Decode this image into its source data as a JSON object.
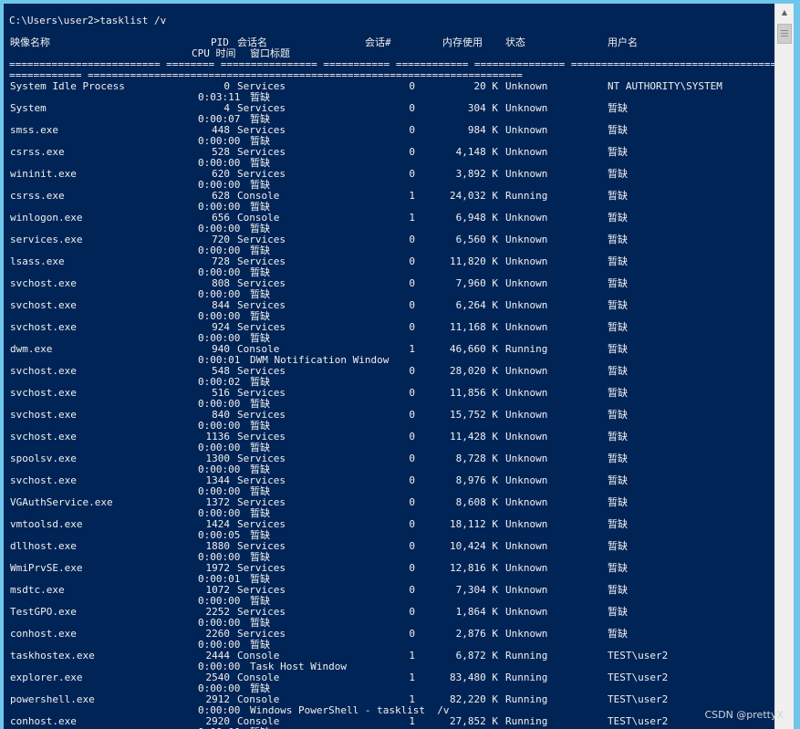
{
  "prompt_line": "C:\\Users\\user2>tasklist /v",
  "headers": {
    "image_name": "映像名称",
    "pid": "PID",
    "session_name": "会话名",
    "session_num": "会话#",
    "mem_usage": "内存使用",
    "status": "状态",
    "user_name": "用户名",
    "cpu_time": "CPU 时间",
    "window_title": "窗口标题"
  },
  "separator_line1": "========================= ======== ================ =========== ============ =============== ==================================================",
  "separator_line2": "============ ========================================================================",
  "processes": [
    {
      "name": "System Idle Process",
      "pid": "0",
      "session": "Services",
      "snum": "0",
      "mem": "20 K",
      "status": "Unknown",
      "user": "NT AUTHORITY\\SYSTEM",
      "cpu": "0:03:11",
      "title": "暂缺"
    },
    {
      "name": "System",
      "pid": "4",
      "session": "Services",
      "snum": "0",
      "mem": "304 K",
      "status": "Unknown",
      "user": "暂缺",
      "cpu": "0:00:07",
      "title": "暂缺"
    },
    {
      "name": "smss.exe",
      "pid": "448",
      "session": "Services",
      "snum": "0",
      "mem": "984 K",
      "status": "Unknown",
      "user": "暂缺",
      "cpu": "0:00:00",
      "title": "暂缺"
    },
    {
      "name": "csrss.exe",
      "pid": "528",
      "session": "Services",
      "snum": "0",
      "mem": "4,148 K",
      "status": "Unknown",
      "user": "暂缺",
      "cpu": "0:00:00",
      "title": "暂缺"
    },
    {
      "name": "wininit.exe",
      "pid": "620",
      "session": "Services",
      "snum": "0",
      "mem": "3,892 K",
      "status": "Unknown",
      "user": "暂缺",
      "cpu": "0:00:00",
      "title": "暂缺"
    },
    {
      "name": "csrss.exe",
      "pid": "628",
      "session": "Console",
      "snum": "1",
      "mem": "24,032 K",
      "status": "Running",
      "user": "暂缺",
      "cpu": "0:00:00",
      "title": "暂缺"
    },
    {
      "name": "winlogon.exe",
      "pid": "656",
      "session": "Console",
      "snum": "1",
      "mem": "6,948 K",
      "status": "Unknown",
      "user": "暂缺",
      "cpu": "0:00:00",
      "title": "暂缺"
    },
    {
      "name": "services.exe",
      "pid": "720",
      "session": "Services",
      "snum": "0",
      "mem": "6,560 K",
      "status": "Unknown",
      "user": "暂缺",
      "cpu": "0:00:00",
      "title": "暂缺"
    },
    {
      "name": "lsass.exe",
      "pid": "728",
      "session": "Services",
      "snum": "0",
      "mem": "11,820 K",
      "status": "Unknown",
      "user": "暂缺",
      "cpu": "0:00:00",
      "title": "暂缺"
    },
    {
      "name": "svchost.exe",
      "pid": "808",
      "session": "Services",
      "snum": "0",
      "mem": "7,960 K",
      "status": "Unknown",
      "user": "暂缺",
      "cpu": "0:00:00",
      "title": "暂缺"
    },
    {
      "name": "svchost.exe",
      "pid": "844",
      "session": "Services",
      "snum": "0",
      "mem": "6,264 K",
      "status": "Unknown",
      "user": "暂缺",
      "cpu": "0:00:00",
      "title": "暂缺"
    },
    {
      "name": "svchost.exe",
      "pid": "924",
      "session": "Services",
      "snum": "0",
      "mem": "11,168 K",
      "status": "Unknown",
      "user": "暂缺",
      "cpu": "0:00:00",
      "title": "暂缺"
    },
    {
      "name": "dwm.exe",
      "pid": "940",
      "session": "Console",
      "snum": "1",
      "mem": "46,660 K",
      "status": "Running",
      "user": "暂缺",
      "cpu": "0:00:01",
      "title": "DWM Notification Window"
    },
    {
      "name": "svchost.exe",
      "pid": "548",
      "session": "Services",
      "snum": "0",
      "mem": "28,020 K",
      "status": "Unknown",
      "user": "暂缺",
      "cpu": "0:00:02",
      "title": "暂缺"
    },
    {
      "name": "svchost.exe",
      "pid": "516",
      "session": "Services",
      "snum": "0",
      "mem": "11,856 K",
      "status": "Unknown",
      "user": "暂缺",
      "cpu": "0:00:00",
      "title": "暂缺"
    },
    {
      "name": "svchost.exe",
      "pid": "840",
      "session": "Services",
      "snum": "0",
      "mem": "15,752 K",
      "status": "Unknown",
      "user": "暂缺",
      "cpu": "0:00:00",
      "title": "暂缺"
    },
    {
      "name": "svchost.exe",
      "pid": "1136",
      "session": "Services",
      "snum": "0",
      "mem": "11,428 K",
      "status": "Unknown",
      "user": "暂缺",
      "cpu": "0:00:00",
      "title": "暂缺"
    },
    {
      "name": "spoolsv.exe",
      "pid": "1300",
      "session": "Services",
      "snum": "0",
      "mem": "8,728 K",
      "status": "Unknown",
      "user": "暂缺",
      "cpu": "0:00:00",
      "title": "暂缺"
    },
    {
      "name": "svchost.exe",
      "pid": "1344",
      "session": "Services",
      "snum": "0",
      "mem": "8,976 K",
      "status": "Unknown",
      "user": "暂缺",
      "cpu": "0:00:00",
      "title": "暂缺"
    },
    {
      "name": "VGAuthService.exe",
      "pid": "1372",
      "session": "Services",
      "snum": "0",
      "mem": "8,608 K",
      "status": "Unknown",
      "user": "暂缺",
      "cpu": "0:00:00",
      "title": "暂缺"
    },
    {
      "name": "vmtoolsd.exe",
      "pid": "1424",
      "session": "Services",
      "snum": "0",
      "mem": "18,112 K",
      "status": "Unknown",
      "user": "暂缺",
      "cpu": "0:00:05",
      "title": "暂缺"
    },
    {
      "name": "dllhost.exe",
      "pid": "1880",
      "session": "Services",
      "snum": "0",
      "mem": "10,424 K",
      "status": "Unknown",
      "user": "暂缺",
      "cpu": "0:00:00",
      "title": "暂缺"
    },
    {
      "name": "WmiPrvSE.exe",
      "pid": "1972",
      "session": "Services",
      "snum": "0",
      "mem": "12,816 K",
      "status": "Unknown",
      "user": "暂缺",
      "cpu": "0:00:01",
      "title": "暂缺"
    },
    {
      "name": "msdtc.exe",
      "pid": "1072",
      "session": "Services",
      "snum": "0",
      "mem": "7,304 K",
      "status": "Unknown",
      "user": "暂缺",
      "cpu": "0:00:00",
      "title": "暂缺"
    },
    {
      "name": "TestGPO.exe",
      "pid": "2252",
      "session": "Services",
      "snum": "0",
      "mem": "1,864 K",
      "status": "Unknown",
      "user": "暂缺",
      "cpu": "0:00:00",
      "title": "暂缺"
    },
    {
      "name": "conhost.exe",
      "pid": "2260",
      "session": "Services",
      "snum": "0",
      "mem": "2,876 K",
      "status": "Unknown",
      "user": "暂缺",
      "cpu": "0:00:00",
      "title": "暂缺"
    },
    {
      "name": "taskhostex.exe",
      "pid": "2444",
      "session": "Console",
      "snum": "1",
      "mem": "6,872 K",
      "status": "Running",
      "user": "TEST\\user2",
      "cpu": "0:00:00",
      "title": "Task Host Window"
    },
    {
      "name": "explorer.exe",
      "pid": "2540",
      "session": "Console",
      "snum": "1",
      "mem": "83,480 K",
      "status": "Running",
      "user": "TEST\\user2",
      "cpu": "0:00:00",
      "title": "暂缺"
    },
    {
      "name": "powershell.exe",
      "pid": "2912",
      "session": "Console",
      "snum": "1",
      "mem": "82,220 K",
      "status": "Running",
      "user": "TEST\\user2",
      "cpu": "0:00:00",
      "title": "Windows PowerShell - tasklist  /v"
    },
    {
      "name": "conhost.exe",
      "pid": "2920",
      "session": "Console",
      "snum": "1",
      "mem": "27,852 K",
      "status": "Running",
      "user": "TEST\\user2",
      "cpu": "0:00:00",
      "title": "暂缺"
    }
  ],
  "watermark": "CSDN @prettyX",
  "colors": {
    "console_bg": "#012456",
    "text": "#f0f0f0",
    "window_frame": "#6ec6ea"
  },
  "icons": {
    "scroll_up": "chevron-up-icon",
    "scroll_grip": "grip-lines-icon"
  }
}
